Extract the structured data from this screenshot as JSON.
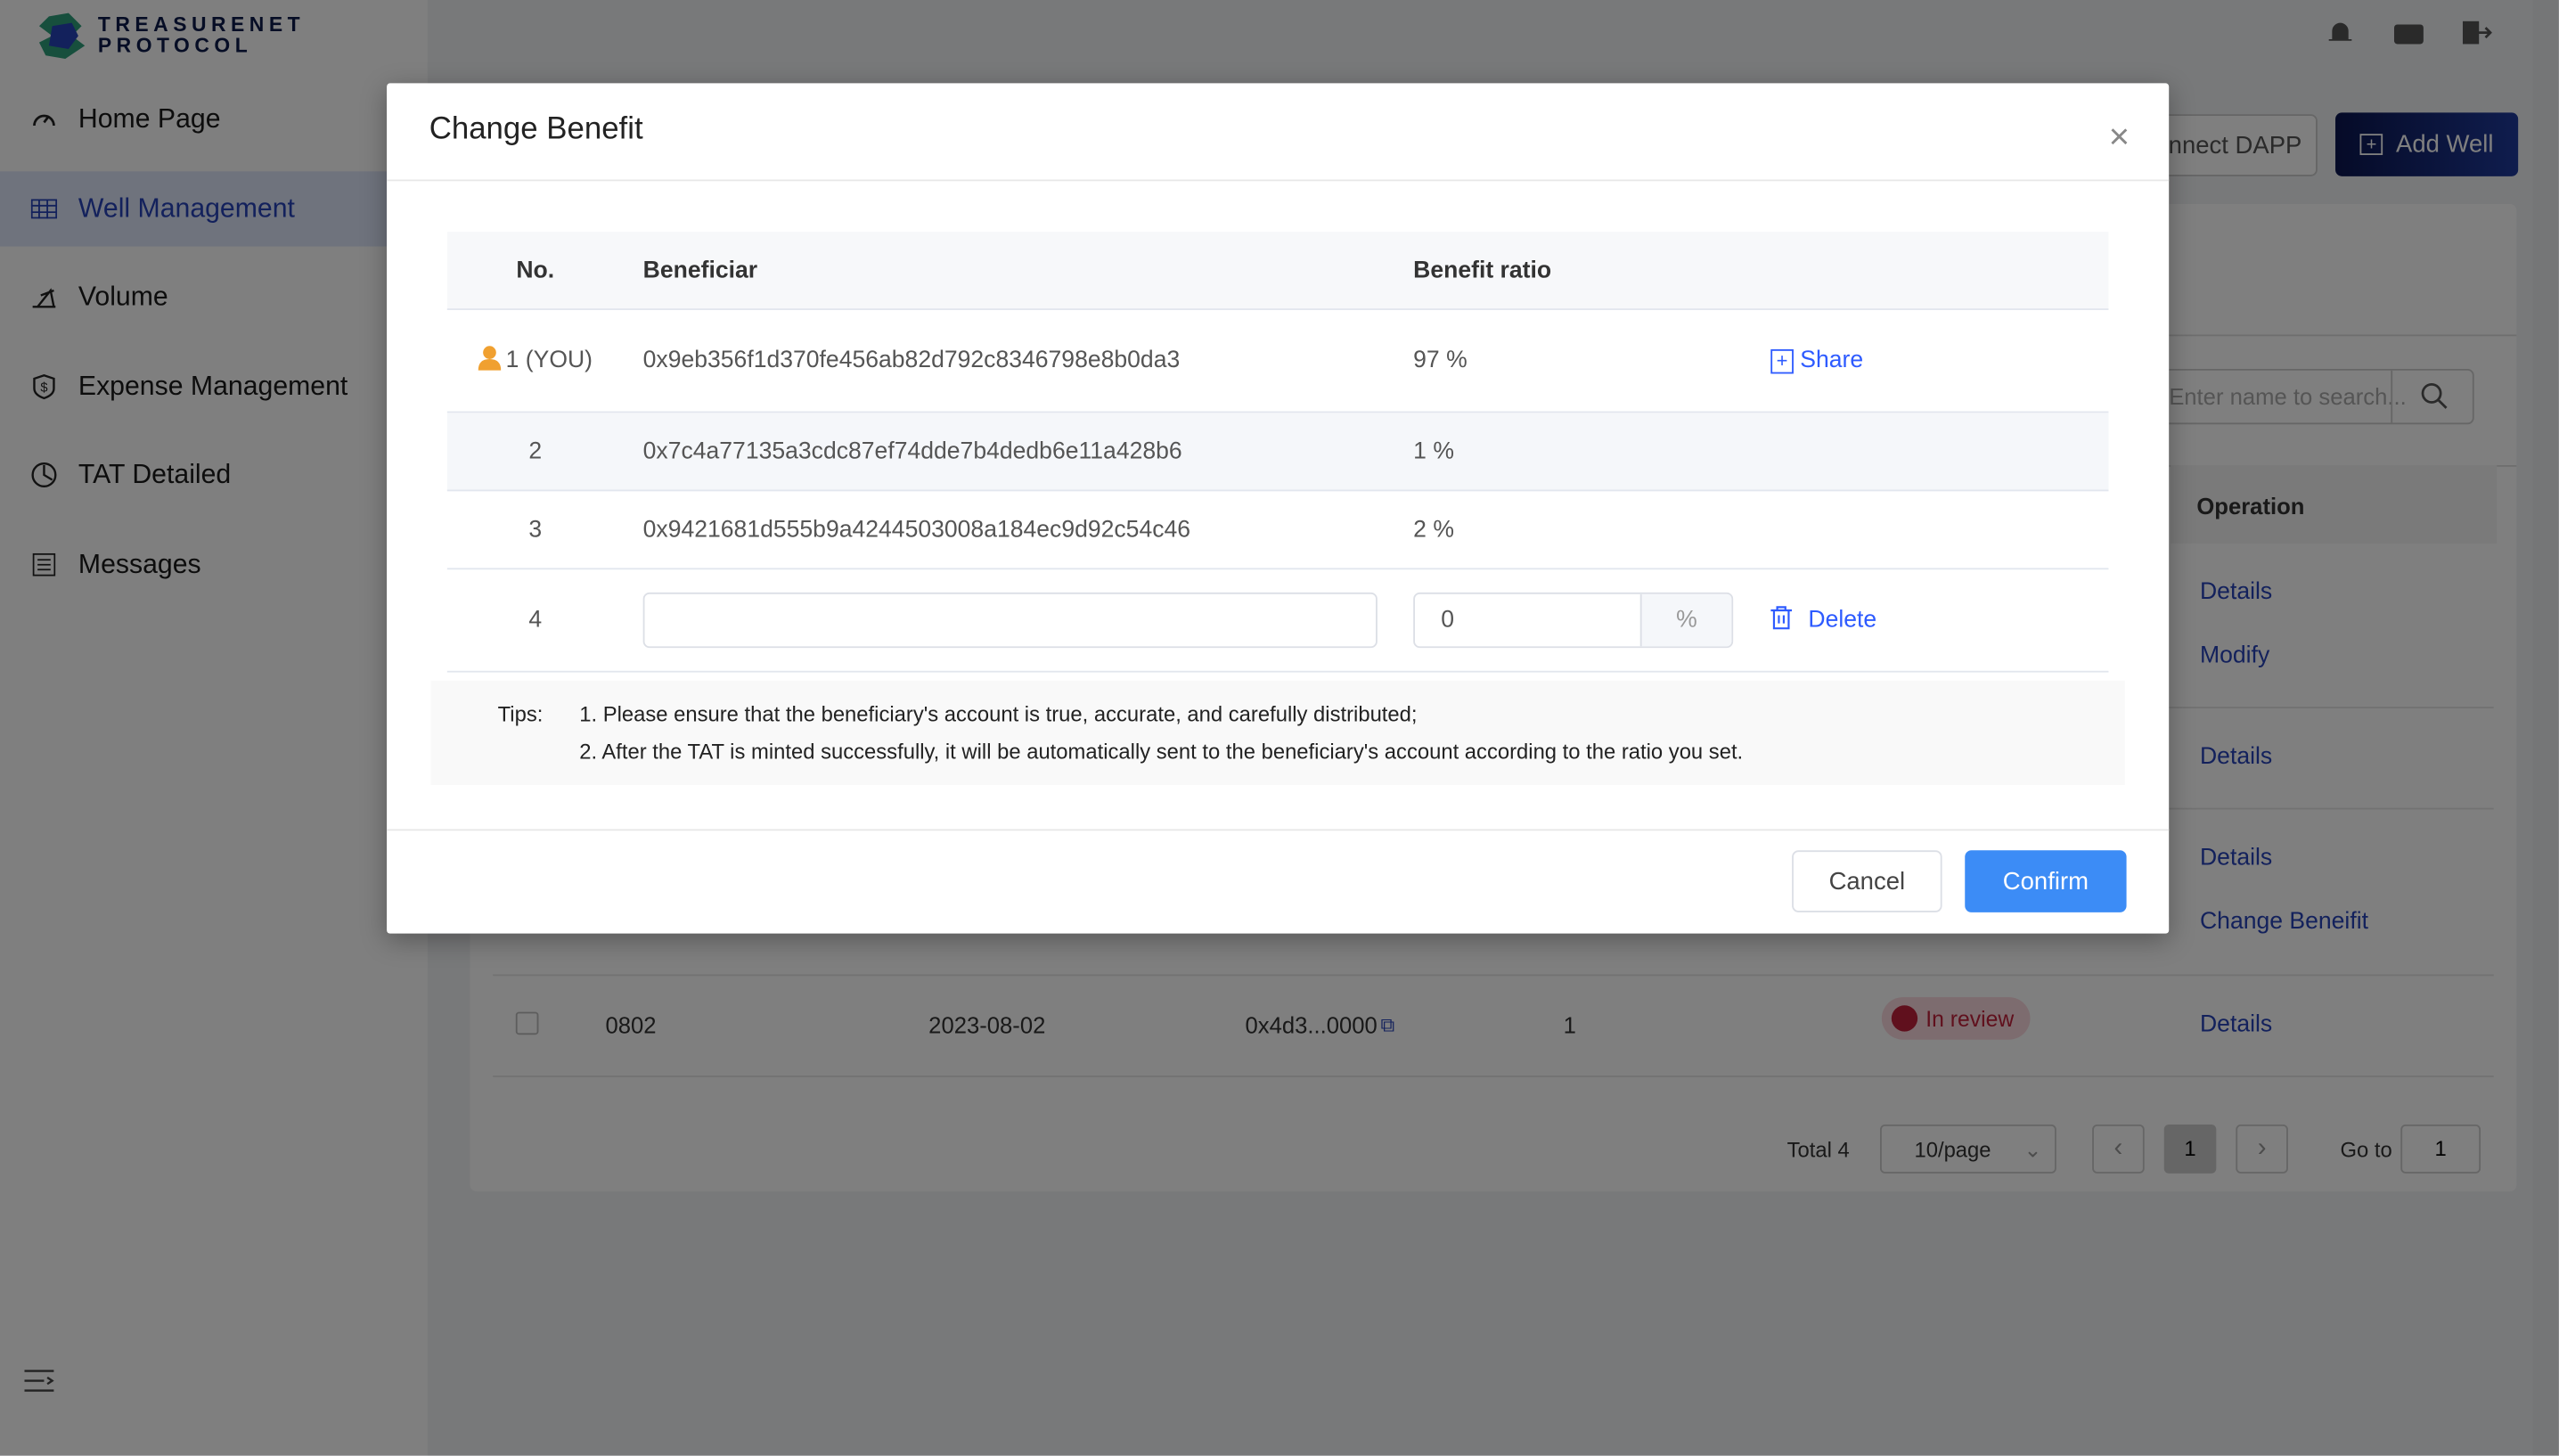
{
  "brand": {
    "line1": "TREASURENET",
    "line2": "PROTOCOL"
  },
  "sidebar": {
    "items": [
      {
        "label": "Home Page",
        "icon": "speedometer-icon"
      },
      {
        "label": "Well Management",
        "icon": "table-icon",
        "active": true
      },
      {
        "label": "Volume",
        "icon": "oil-pump-icon"
      },
      {
        "label": "Expense Management",
        "icon": "shield-dollar-icon"
      },
      {
        "label": "TAT Detailed",
        "icon": "pie-clock-icon"
      },
      {
        "label": "Messages",
        "icon": "list-icon"
      }
    ]
  },
  "header": {
    "icons": [
      "bell-icon",
      "wallet-icon",
      "logout-icon"
    ]
  },
  "toolbar": {
    "connect_label": "Connect DAPP",
    "add_label": "Add Well"
  },
  "search": {
    "placeholder": "Enter name to search..."
  },
  "bg_table": {
    "operation_header": "Operation",
    "ops": [
      [
        "Details",
        "Modify"
      ],
      [
        "Details"
      ],
      [
        "Details",
        "Change Beneifit"
      ]
    ],
    "last_row": {
      "name": "0802",
      "date": "2023-08-02",
      "address": "0x4d3...0000",
      "count": "1",
      "status": "In review",
      "op": "Details"
    }
  },
  "pagination": {
    "total": "Total 4",
    "page_size": "10/page",
    "current": "1",
    "goto_label": "Go to",
    "goto_value": "1"
  },
  "modal": {
    "title": "Change Benefit",
    "headers": {
      "no": "No.",
      "beneficiary": "Beneficiar",
      "ratio": "Benefit ratio"
    },
    "rows": [
      {
        "no": "1 (YOU)",
        "address": "0x9eb356f1d370fe456ab82d792c8346798e8b0da3",
        "ratio": "97 %",
        "action": "Share"
      },
      {
        "no": "2",
        "address": "0x7c4a77135a3cdc87ef74dde7b4dedb6e11a428b6",
        "ratio": "1 %"
      },
      {
        "no": "3",
        "address": "0x9421681d555b9a4244503008a184ec9d92c54c46",
        "ratio": "2 %"
      }
    ],
    "new_row": {
      "no": "4",
      "address": "",
      "ratio": "0",
      "unit": "%",
      "action": "Delete"
    },
    "tips_label": "Tips:",
    "tips": [
      "1. Please ensure that the beneficiary's account is true, accurate, and carefully distributed;",
      "2. After the TAT is minted successfully, it will be automatically sent to the beneficiary's account according to the ratio you set."
    ],
    "cancel": "Cancel",
    "confirm": "Confirm"
  },
  "colors": {
    "primary": "#3c8cf6",
    "link": "#2743b8",
    "brand": "#0e1f6b",
    "user_icon": "#f0a030",
    "status": "#c0203a"
  }
}
